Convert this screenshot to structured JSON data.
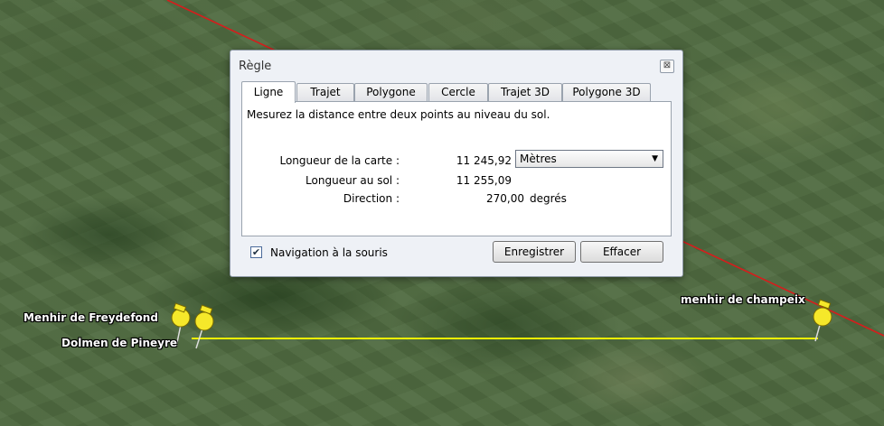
{
  "map": {
    "placemarks": [
      {
        "label": "Menhir de Freydefond"
      },
      {
        "label": "Dolmen de Pineyre"
      },
      {
        "label": "menhir de champeix"
      }
    ],
    "colors": {
      "measure_line": "#f0f000",
      "path_line": "#d81c1c",
      "pin": "#f5e82a"
    }
  },
  "dialog": {
    "title": "Règle",
    "close_icon": "close-icon",
    "tabs": [
      {
        "label": "Ligne",
        "active": true
      },
      {
        "label": "Trajet"
      },
      {
        "label": "Polygone"
      },
      {
        "label": "Cercle"
      },
      {
        "label": "Trajet 3D"
      },
      {
        "label": "Polygone 3D"
      }
    ],
    "description": "Mesurez la distance entre deux points au niveau du sol.",
    "rows": {
      "map_length": {
        "label": "Longueur de la carte :",
        "value": "11 245,92"
      },
      "ground_length": {
        "label": "Longueur au sol :",
        "value": "11 255,09"
      },
      "direction": {
        "label": "Direction :",
        "value": "270,00",
        "unit": "degrés"
      }
    },
    "unit_select": {
      "selected": "Mètres"
    },
    "mouse_navigation": {
      "label": "Navigation à la souris",
      "checked": true
    },
    "buttons": {
      "save": "Enregistrer",
      "clear": "Effacer"
    }
  }
}
